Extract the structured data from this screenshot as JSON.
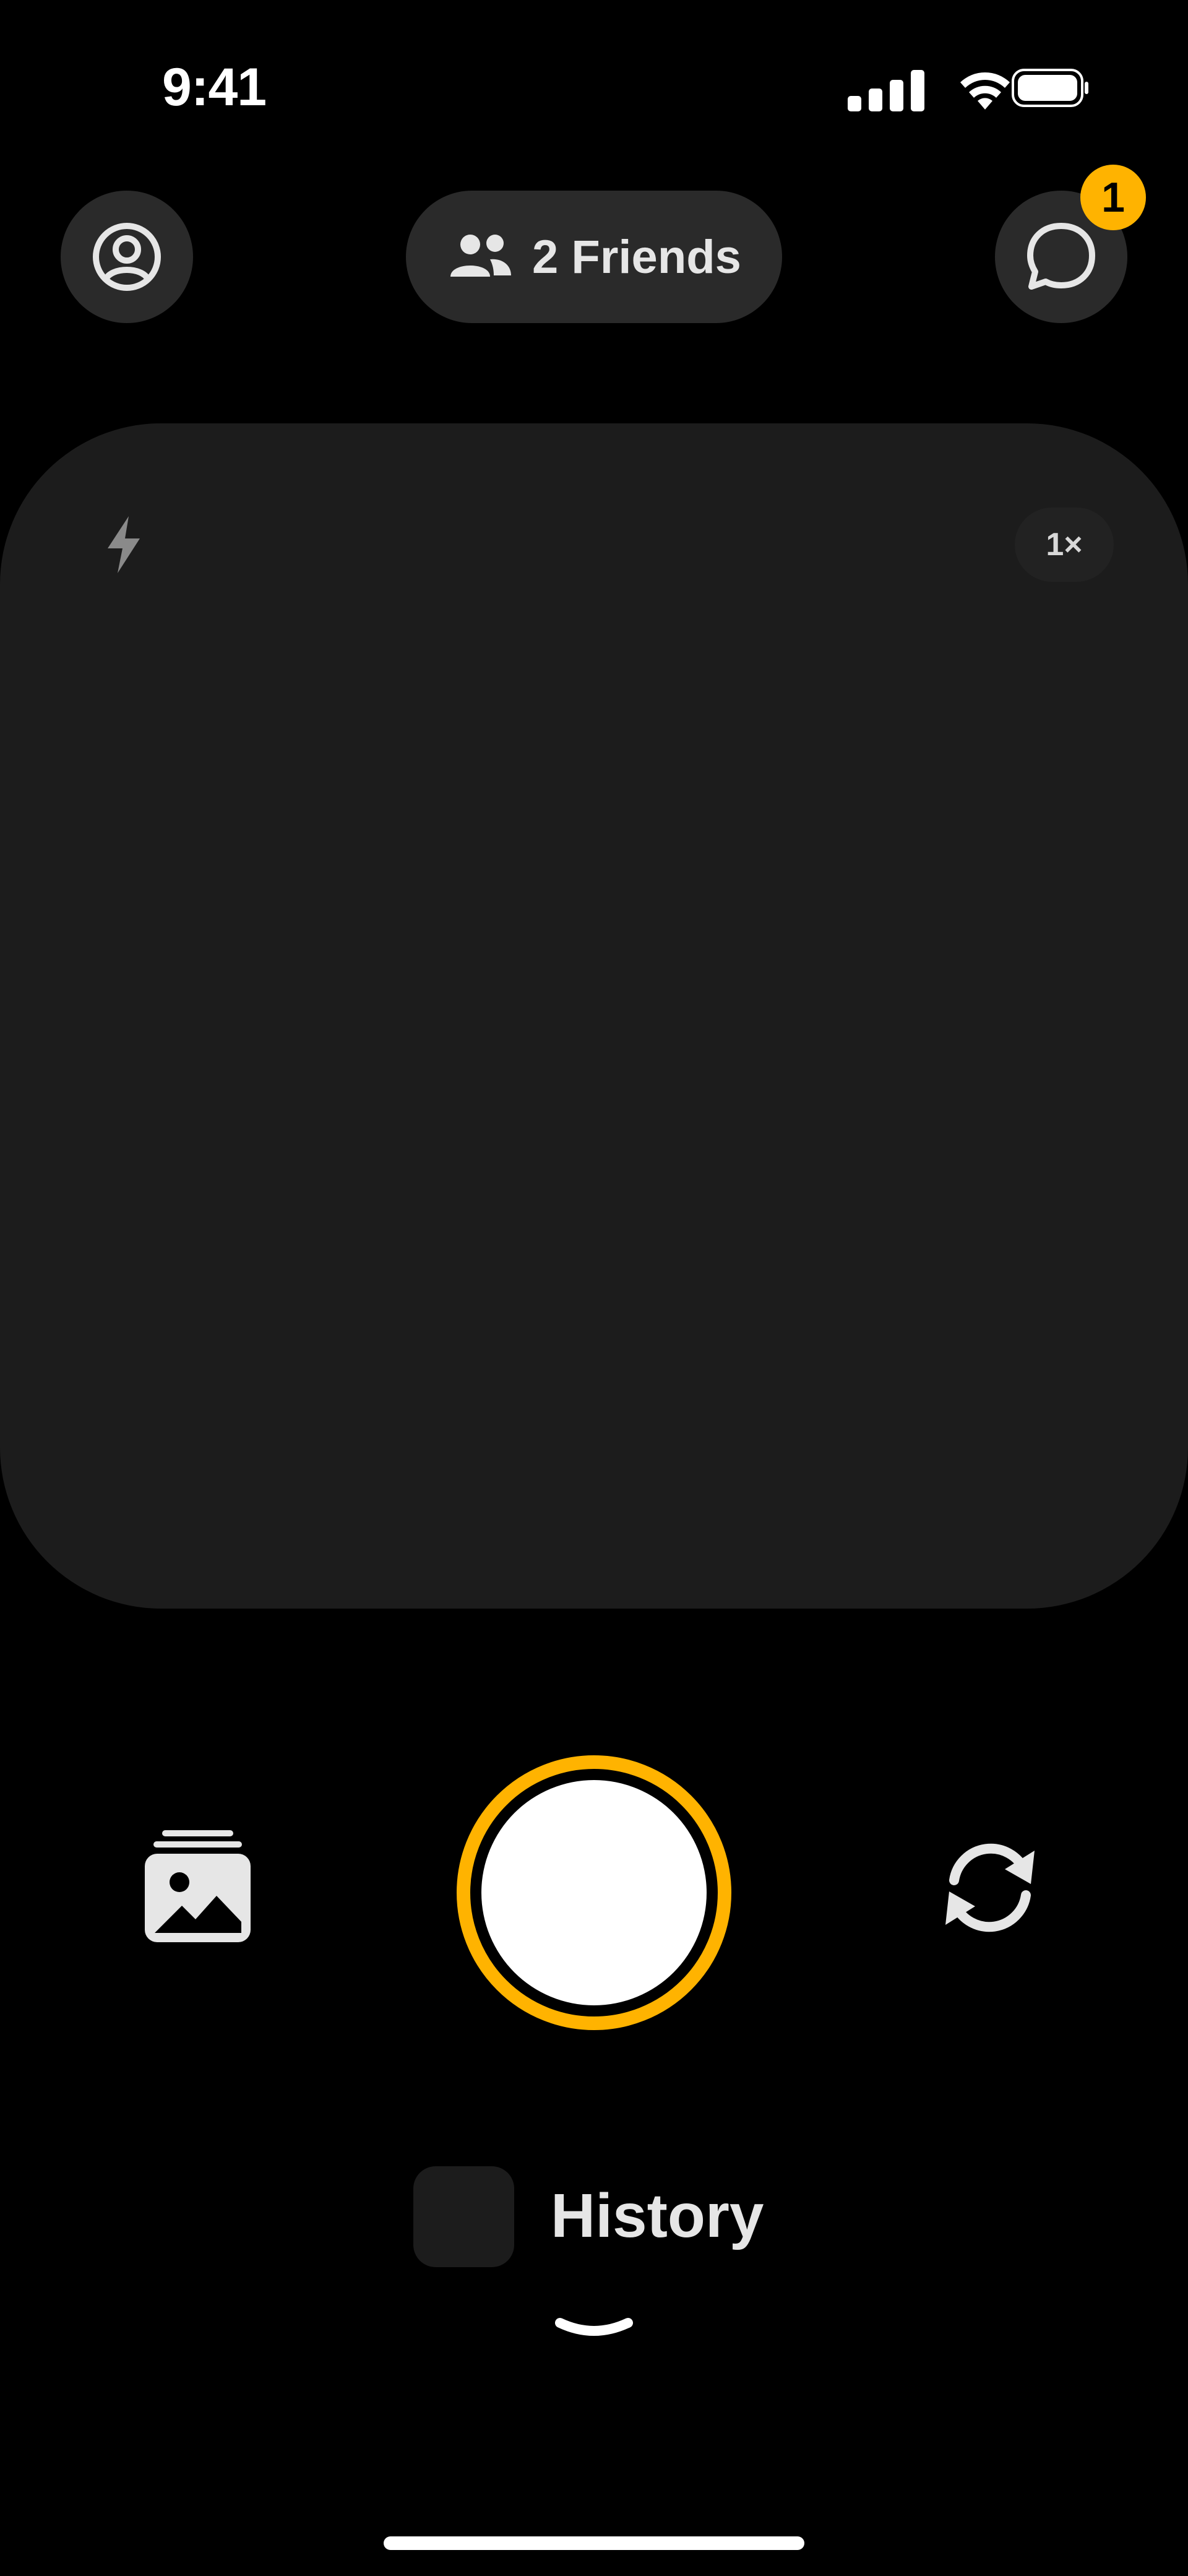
{
  "status_bar": {
    "time": "9:41",
    "icons": [
      "signal-icon",
      "wifi-icon",
      "battery-icon"
    ]
  },
  "header": {
    "profile_icon": "person-circle-icon",
    "friends_label": "2 Friends",
    "friends_icon": "people-icon",
    "chat_icon": "chat-bubble-icon",
    "chat_badge": "1"
  },
  "camera": {
    "flash_icon": "flash-icon",
    "zoom_label": "1×"
  },
  "controls": {
    "gallery_icon": "photo-stack-icon",
    "shutter": "shutter-button",
    "flip_icon": "camera-flip-icon"
  },
  "history": {
    "label": "History",
    "chevron_icon": "chevron-down-icon"
  },
  "colors": {
    "accent": "#FFB300",
    "background": "#000000",
    "surface": "#2a2a2a",
    "viewfinder": "#1c1c1c"
  }
}
